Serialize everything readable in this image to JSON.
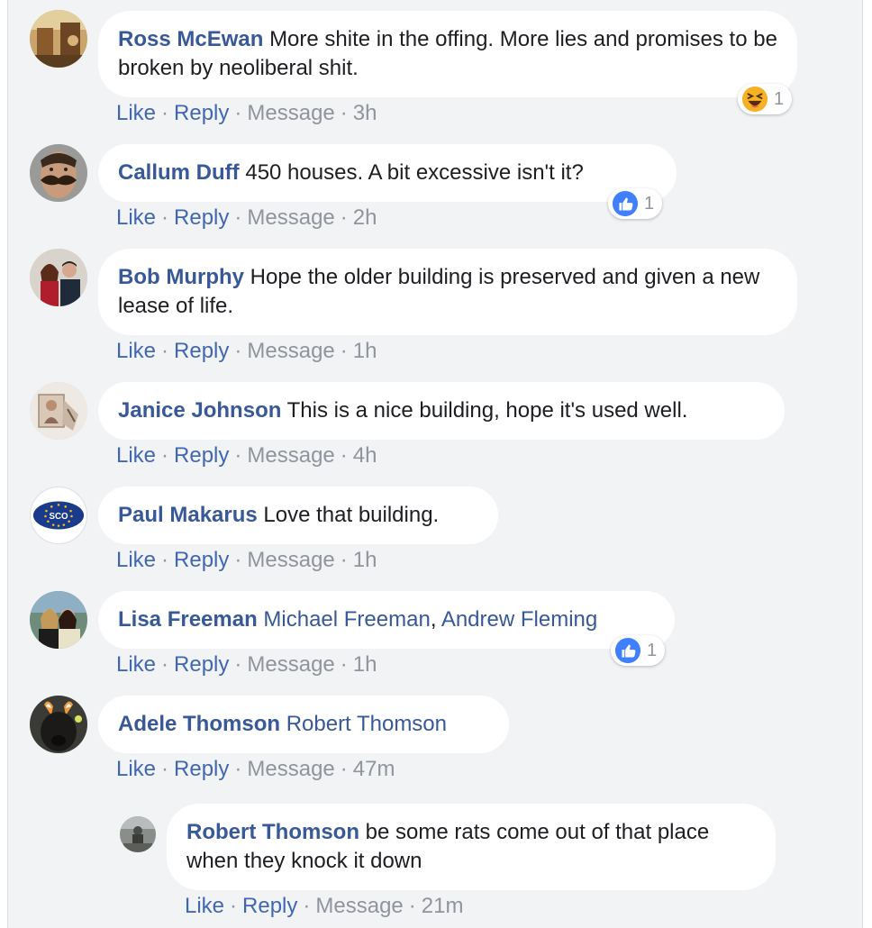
{
  "actions": {
    "like": "Like",
    "reply": "Reply",
    "message": "Message",
    "sep": "·"
  },
  "colors": {
    "link": "#385898",
    "action_link": "#4267b2",
    "muted": "#90949c",
    "like_blue": "#4080ff",
    "haha_yellow": "#f7b125"
  },
  "comments": [
    {
      "author": "Ross McEwan",
      "text": "More shite in the offing. More lies and promises to be broken by neoliberal shit.",
      "time": "3h",
      "reaction": {
        "icon": "haha-emoji-icon",
        "count": "1"
      }
    },
    {
      "author": "Callum Duff",
      "text": "450 houses. A bit excessive isn't it?",
      "time": "2h",
      "reaction": {
        "icon": "like-thumb-icon",
        "count": "1"
      }
    },
    {
      "author": "Bob Murphy",
      "text": "Hope the older building is preserved and given a new lease of life.",
      "time": "1h"
    },
    {
      "author": "Janice Johnson",
      "text": "This is a nice building, hope it's used well.",
      "time": "4h"
    },
    {
      "author": "Paul Makarus",
      "text": "Love that building.",
      "time": "1h",
      "avatar_text": "SCO"
    },
    {
      "author": "Lisa Freeman",
      "mentions": [
        "Michael Freeman",
        "Andrew Fleming"
      ],
      "mention_sep": ",",
      "time": "1h",
      "reaction": {
        "icon": "like-thumb-icon",
        "count": "1"
      }
    },
    {
      "author": "Adele Thomson",
      "mentions": [
        "Robert Thomson"
      ],
      "time": "47m"
    }
  ],
  "replies": [
    {
      "author": "Robert Thomson",
      "text": "be some rats come out of that place when they knock it down",
      "time": "21m"
    }
  ]
}
